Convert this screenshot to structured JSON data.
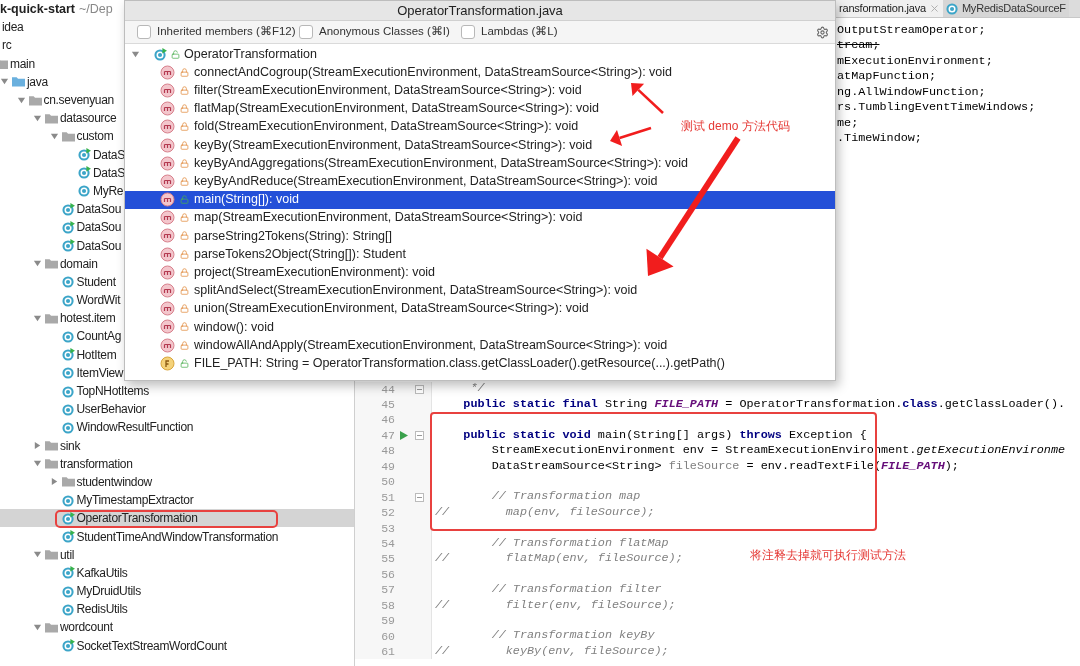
{
  "project_tree": {
    "name": "k-quick-start",
    "path": "~/Dep",
    "children": [
      {
        "label": "idea",
        "selected": false
      },
      {
        "label": "rc",
        "selected": false,
        "children": [
          {
            "label": "main",
            "kind": "folder",
            "selected": false,
            "children": [
              {
                "label": "java",
                "kind": "source-folder",
                "expanded": true,
                "selected": false,
                "children": [
                  {
                    "label": "cn.sevenyuan",
                    "kind": "folder",
                    "expanded": true,
                    "selected": false,
                    "children": [
                      {
                        "label": "datasource",
                        "kind": "folder",
                        "expanded": true,
                        "selected": false,
                        "children": [
                          {
                            "label": "custom",
                            "kind": "folder",
                            "expanded": true,
                            "selected": false,
                            "children": [
                              {
                                "label": "DataS",
                                "kind": "class",
                                "runnable": true,
                                "selected": false
                              },
                              {
                                "label": "DataS",
                                "kind": "class",
                                "runnable": true,
                                "selected": false
                              },
                              {
                                "label": "MyRe",
                                "kind": "class",
                                "runnable": false,
                                "selected": false
                              }
                            ]
                          },
                          {
                            "label": "DataSou",
                            "kind": "class",
                            "runnable": true,
                            "selected": false
                          },
                          {
                            "label": "DataSou",
                            "kind": "class",
                            "runnable": true,
                            "selected": false
                          },
                          {
                            "label": "DataSou",
                            "kind": "class",
                            "runnable": true,
                            "selected": false
                          }
                        ]
                      },
                      {
                        "label": "domain",
                        "kind": "folder",
                        "expanded": true,
                        "selected": false,
                        "children": [
                          {
                            "label": "Student",
                            "kind": "class",
                            "runnable": false,
                            "selected": false
                          },
                          {
                            "label": "WordWit",
                            "kind": "class",
                            "runnable": false,
                            "selected": false
                          }
                        ]
                      },
                      {
                        "label": "hotest.item",
                        "kind": "folder",
                        "expanded": true,
                        "selected": false,
                        "children": [
                          {
                            "label": "CountAg",
                            "kind": "class",
                            "runnable": false,
                            "selected": false
                          },
                          {
                            "label": "HotItem",
                            "kind": "class",
                            "runnable": true,
                            "selected": false
                          },
                          {
                            "label": "ItemView",
                            "kind": "class",
                            "runnable": false,
                            "selected": false
                          },
                          {
                            "label": "TopNHotItems",
                            "kind": "class",
                            "runnable": false,
                            "selected": false
                          },
                          {
                            "label": "UserBehavior",
                            "kind": "class",
                            "runnable": false,
                            "selected": false
                          },
                          {
                            "label": "WindowResultFunction",
                            "kind": "class",
                            "runnable": false,
                            "selected": false
                          }
                        ]
                      },
                      {
                        "label": "sink",
                        "kind": "folder",
                        "expanded": false,
                        "selected": false
                      },
                      {
                        "label": "transformation",
                        "kind": "folder",
                        "expanded": true,
                        "selected": false,
                        "children": [
                          {
                            "label": "studentwindow",
                            "kind": "folder",
                            "expanded": false,
                            "selected": false
                          },
                          {
                            "label": "MyTimestampExtractor",
                            "kind": "class",
                            "runnable": false,
                            "selected": false
                          },
                          {
                            "label": "OperatorTransformation",
                            "kind": "class",
                            "runnable": true,
                            "selected": true
                          },
                          {
                            "label": "StudentTimeAndWindowTransformation",
                            "kind": "class",
                            "runnable": true,
                            "selected": false
                          }
                        ]
                      },
                      {
                        "label": "util",
                        "kind": "folder",
                        "expanded": true,
                        "selected": false,
                        "children": [
                          {
                            "label": "KafkaUtils",
                            "kind": "class",
                            "runnable": true,
                            "selected": false
                          },
                          {
                            "label": "MyDruidUtils",
                            "kind": "class",
                            "runnable": false,
                            "selected": false
                          },
                          {
                            "label": "RedisUtils",
                            "kind": "class",
                            "runnable": false,
                            "selected": false
                          }
                        ]
                      },
                      {
                        "label": "wordcount",
                        "kind": "folder",
                        "expanded": true,
                        "selected": false,
                        "children": [
                          {
                            "label": "SocketTextStreamWordCount",
                            "kind": "class",
                            "runnable": true,
                            "selected": false
                          }
                        ]
                      }
                    ]
                  }
                ]
              }
            ]
          }
        ]
      }
    ]
  },
  "editor": {
    "tabs": [
      {
        "label": "ransformation.java",
        "selected": true,
        "closable": true
      },
      {
        "label": "MyRedisDataSourceF",
        "selected": false
      }
    ],
    "import_fragments": [
      {
        "text": "OutputStreamOperator;",
        "deprecated": false
      },
      {
        "text": "tream;",
        "deprecated": true
      },
      {
        "text": "mExecutionEnvironment;",
        "deprecated": false
      },
      {
        "text": "atMapFunction;",
        "deprecated": false
      },
      {
        "text": "ng.AllWindowFunction;",
        "deprecated": false
      },
      {
        "text": "rs.TumblingEventTimeWindows;",
        "deprecated": false
      },
      {
        "text": "me;",
        "deprecated": false
      },
      {
        "text": ".TimeWindow;",
        "deprecated": false
      }
    ],
    "lines": [
      {
        "number": "44",
        "run": false,
        "fold": true,
        "tokens": [
          {
            "text": "     */",
            "kind": "comment"
          }
        ]
      },
      {
        "number": "45",
        "run": false,
        "fold": false,
        "tokens": [
          {
            "text": "    public static final",
            "kind": "keyword"
          },
          {
            "text": " String ",
            "kind": "plain"
          },
          {
            "text": "FILE_PATH",
            "kind": "constant"
          },
          {
            "text": " = OperatorTransformation.",
            "kind": "plain"
          },
          {
            "text": "class",
            "kind": "keyword"
          },
          {
            "text": ".getClassLoader().",
            "kind": "plain"
          }
        ]
      },
      {
        "number": "46",
        "run": false,
        "fold": false
      },
      {
        "number": "47",
        "run": true,
        "fold": true,
        "tokens": [
          {
            "text": "    public static void",
            "kind": "keyword"
          },
          {
            "text": " main(String[] args) ",
            "kind": "plain"
          },
          {
            "text": "throws",
            "kind": "keyword"
          },
          {
            "text": " Exception {",
            "kind": "plain"
          }
        ]
      },
      {
        "number": "48",
        "run": false,
        "fold": false,
        "tokens": [
          {
            "text": "        StreamExecutionEnvironment env = StreamExecutionEnvironment.",
            "kind": "plain"
          },
          {
            "text": "getExecutionEnvironme",
            "kind": "static-call"
          }
        ]
      },
      {
        "number": "49",
        "run": false,
        "fold": false,
        "tokens": [
          {
            "text": "        DataStreamSource<String> ",
            "kind": "plain"
          },
          {
            "text": "fileSource",
            "kind": "unused"
          },
          {
            "text": " = env.readTextFile(",
            "kind": "plain"
          },
          {
            "text": "FILE_PATH",
            "kind": "constant"
          },
          {
            "text": ");",
            "kind": "plain"
          }
        ]
      },
      {
        "number": "50",
        "run": false,
        "fold": false
      },
      {
        "number": "51",
        "run": false,
        "fold": true,
        "tokens": [
          {
            "text": "        // Transformation map",
            "kind": "comment"
          }
        ]
      },
      {
        "number": "52",
        "run": false,
        "fold": false,
        "tokens": [
          {
            "text": "//        map(env, fileSource);",
            "kind": "comment"
          }
        ]
      },
      {
        "number": "53",
        "run": false,
        "fold": false
      },
      {
        "number": "54",
        "run": false,
        "fold": false,
        "tokens": [
          {
            "text": "        // Transformation flatMap",
            "kind": "comment"
          }
        ]
      },
      {
        "number": "55",
        "run": false,
        "fold": false,
        "tokens": [
          {
            "text": "//        flatMap(env, fileSource);",
            "kind": "comment"
          }
        ]
      },
      {
        "number": "56",
        "run": false,
        "fold": false
      },
      {
        "number": "57",
        "run": false,
        "fold": false,
        "tokens": [
          {
            "text": "        // Transformation filter",
            "kind": "comment"
          }
        ]
      },
      {
        "number": "58",
        "run": false,
        "fold": false,
        "tokens": [
          {
            "text": "//        filter(env, fileSource);",
            "kind": "comment"
          }
        ]
      },
      {
        "number": "59",
        "run": false,
        "fold": false
      },
      {
        "number": "60",
        "run": false,
        "fold": false,
        "tokens": [
          {
            "text": "        // Transformation keyBy",
            "kind": "comment"
          }
        ]
      },
      {
        "number": "61",
        "run": false,
        "fold": false,
        "tokens": [
          {
            "text": "//        keyBy(env, fileSource);",
            "kind": "comment"
          }
        ]
      }
    ]
  },
  "structure_popup": {
    "title": "OperatorTransformation.java",
    "filters": [
      {
        "label": "Inherited members (⌘F12)",
        "checked": false
      },
      {
        "label": "Anonymous Classes (⌘I)",
        "checked": false
      },
      {
        "label": "Lambdas (⌘L)",
        "checked": false
      }
    ],
    "class_node": {
      "label": "OperatorTransformation",
      "expanded": true,
      "members": [
        {
          "kind": "method",
          "private": true,
          "signature": "connectAndCogroup(StreamExecutionEnvironment, DataStreamSource<String>): void",
          "selected": false
        },
        {
          "kind": "method",
          "private": true,
          "signature": "filter(StreamExecutionEnvironment, DataStreamSource<String>): void",
          "selected": false
        },
        {
          "kind": "method",
          "private": true,
          "signature": "flatMap(StreamExecutionEnvironment, DataStreamSource<String>): void",
          "selected": false
        },
        {
          "kind": "method",
          "private": true,
          "signature": "fold(StreamExecutionEnvironment, DataStreamSource<String>): void",
          "selected": false
        },
        {
          "kind": "method",
          "private": true,
          "signature": "keyBy(StreamExecutionEnvironment, DataStreamSource<String>): void",
          "selected": false
        },
        {
          "kind": "method",
          "private": true,
          "signature": "keyByAndAggregations(StreamExecutionEnvironment, DataStreamSource<String>): void",
          "selected": false
        },
        {
          "kind": "method",
          "private": true,
          "signature": "keyByAndReduce(StreamExecutionEnvironment, DataStreamSource<String>): void",
          "selected": false
        },
        {
          "kind": "method",
          "private": false,
          "signature": "main(String[]): void",
          "selected": true
        },
        {
          "kind": "method",
          "private": true,
          "signature": "map(StreamExecutionEnvironment, DataStreamSource<String>): void",
          "selected": false
        },
        {
          "kind": "method",
          "private": true,
          "signature": "parseString2Tokens(String): String[]",
          "selected": false
        },
        {
          "kind": "method",
          "private": true,
          "signature": "parseTokens2Object(String[]): Student",
          "selected": false
        },
        {
          "kind": "method",
          "private": true,
          "signature": "project(StreamExecutionEnvironment): void",
          "selected": false
        },
        {
          "kind": "method",
          "private": true,
          "signature": "splitAndSelect(StreamExecutionEnvironment, DataStreamSource<String>): void",
          "selected": false
        },
        {
          "kind": "method",
          "private": true,
          "signature": "union(StreamExecutionEnvironment, DataStreamSource<String>): void",
          "selected": false
        },
        {
          "kind": "method",
          "private": true,
          "signature": "window(): void",
          "selected": false
        },
        {
          "kind": "method",
          "private": true,
          "signature": "windowAllAndApply(StreamExecutionEnvironment, DataStreamSource<String>): void",
          "selected": false
        },
        {
          "kind": "field",
          "private": false,
          "signature": "FILE_PATH: String = OperatorTransformation.class.getClassLoader().getResource(...).getPath()",
          "selected": false
        }
      ]
    }
  },
  "annotations": {
    "notes": [
      "测试 demo 方法代码",
      "将注释去掉就可执行测试方法"
    ]
  }
}
